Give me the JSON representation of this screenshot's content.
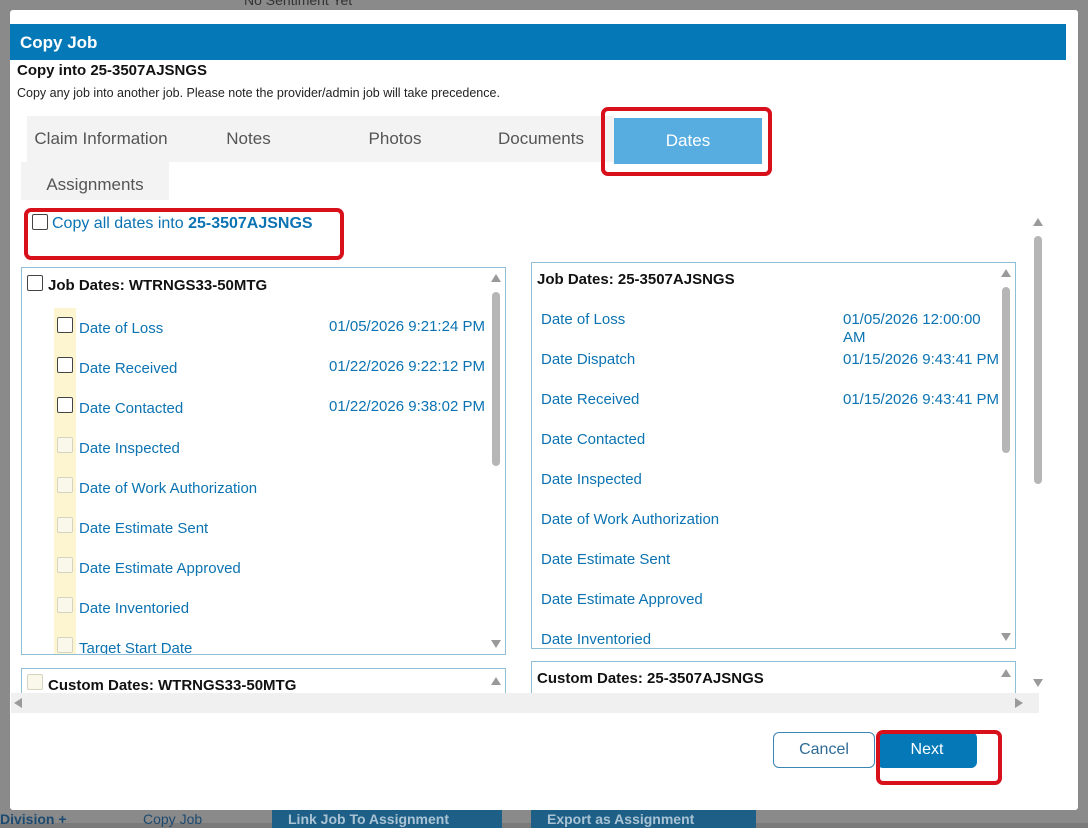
{
  "background": {
    "top_text": "No Sentiment Yet",
    "bottom_link_1": "Division +",
    "bottom_link_2": "Copy Job",
    "bottom_btn_1": "Link Job To Assignment",
    "bottom_btn_2": "Export as Assignment"
  },
  "modal": {
    "title": "Copy Job",
    "subtitle": "Copy into 25-3507AJSNGS",
    "note": "Copy any job into another job. Please note the provider/admin job will take precedence."
  },
  "tabs": [
    {
      "label": "Claim Information"
    },
    {
      "label": "Notes"
    },
    {
      "label": "Photos"
    },
    {
      "label": "Documents"
    },
    {
      "label": "Dates"
    },
    {
      "label": "Assignments"
    }
  ],
  "copy_all": {
    "prefix": "Copy all dates into ",
    "job": "25-3507AJSNGS"
  },
  "source_panel": {
    "title": "Job Dates: WTRNGS33-50MTG",
    "rows": [
      {
        "label": "Date of Loss",
        "value": "01/05/2026 9:21:24 PM"
      },
      {
        "label": "Date Received",
        "value": "01/22/2026 9:22:12 PM"
      },
      {
        "label": "Date Contacted",
        "value": "01/22/2026 9:38:02 PM"
      },
      {
        "label": "Date Inspected",
        "value": ""
      },
      {
        "label": "Date of Work Authorization",
        "value": ""
      },
      {
        "label": "Date Estimate Sent",
        "value": ""
      },
      {
        "label": "Date Estimate Approved",
        "value": ""
      },
      {
        "label": "Date Inventoried",
        "value": ""
      },
      {
        "label": "Target Start Date",
        "value": ""
      }
    ]
  },
  "source_custom": {
    "title": "Custom Dates: WTRNGS33-50MTG"
  },
  "target_panel": {
    "title": "Job Dates: 25-3507AJSNGS",
    "rows": [
      {
        "label": "Date of Loss",
        "value_line1": "01/05/2026 12:00:00",
        "value_line2": "AM"
      },
      {
        "label": "Date Dispatch",
        "value_line1": "01/15/2026 9:43:41 PM",
        "value_line2": ""
      },
      {
        "label": "Date Received",
        "value_line1": "01/15/2026 9:43:41 PM",
        "value_line2": ""
      },
      {
        "label": "Date Contacted",
        "value_line1": "",
        "value_line2": ""
      },
      {
        "label": "Date Inspected",
        "value_line1": "",
        "value_line2": ""
      },
      {
        "label": "Date of Work Authorization",
        "value_line1": "",
        "value_line2": ""
      },
      {
        "label": "Date Estimate Sent",
        "value_line1": "",
        "value_line2": ""
      },
      {
        "label": "Date Estimate Approved",
        "value_line1": "",
        "value_line2": ""
      },
      {
        "label": "Date Inventoried",
        "value_line1": "",
        "value_line2": ""
      }
    ]
  },
  "target_custom": {
    "title": "Custom Dates: 25-3507AJSNGS"
  },
  "footer": {
    "cancel": "Cancel",
    "next": "Next"
  },
  "colors": {
    "header": "#0579b8",
    "active_tab": "#57ade0",
    "highlight": "#d8101c",
    "link": "#0b73b2"
  }
}
